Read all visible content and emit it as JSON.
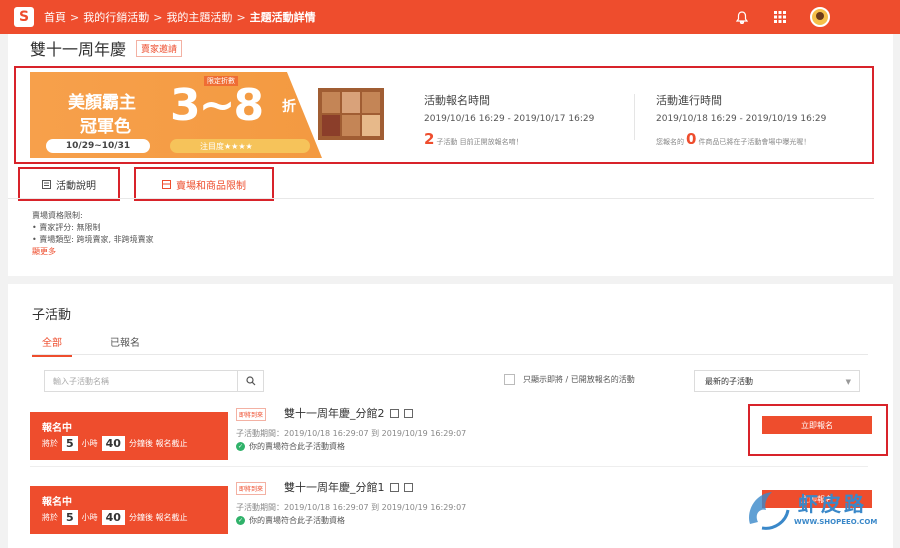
{
  "topbar": {
    "logo": "S",
    "breadcrumbs": [
      "首頁",
      "我的行銷活動",
      "我的主題活動",
      "主題活動詳情"
    ],
    "sep": ">"
  },
  "activity": {
    "title": "雙十一周年慶",
    "badge": "賣家邀請",
    "banner": {
      "line1": "美顏霸主",
      "line2": "冠軍色",
      "big": "3~8",
      "zhe": "折",
      "small": "限定折數",
      "date": "10/29~10/31",
      "stars": "注目度★★★★"
    },
    "register": {
      "label": "活動報名時間",
      "range": "2019/10/16 16:29 - 2019/10/17 16:29",
      "count": "2",
      "note": "子活動 目前正開放報名唷！"
    },
    "running": {
      "label": "活動進行時間",
      "range": "2019/10/18 16:29 - 2019/10/19 16:29",
      "prefix": "您報名的",
      "count": "0",
      "note": "件商品已將在子活動會場中曝光喔！"
    },
    "tabs": {
      "desc": "活動說明",
      "limits": "賣場和商品限制"
    },
    "requirements": {
      "title": "賣場資格限制:",
      "items": [
        "賣家評分: 無限制",
        "賣場類型: 跨境賣家, 非跨境賣家"
      ],
      "more": "顯更多"
    }
  },
  "sub": {
    "title": "子活動",
    "tab_all": "全部",
    "tab_signed": "已報名",
    "search_placeholder": "輸入子活動名稱",
    "filter_label": "只顯示即將 / 已開放報名的活動",
    "sort_value": "最新的子活動",
    "rows": [
      {
        "status": "報名中",
        "pre": "將於",
        "hours": "5",
        "hours_unit": "小時",
        "mins": "40",
        "mins_post": "分鐘後 報名截止",
        "tag": "即將到來",
        "name": "雙十一周年慶_分館2",
        "period": "子活動期間：2019/10/18 16:29:07 到 2019/10/19 16:29:07",
        "eligible": "你的賣場符合此子活動資格",
        "button": "立即報名"
      },
      {
        "status": "報名中",
        "pre": "將於",
        "hours": "5",
        "hours_unit": "小時",
        "mins": "40",
        "mins_post": "分鐘後 報名截止",
        "tag": "即將到來",
        "name": "雙十一周年慶_分館1",
        "period": "子活動期間：2019/10/18 16:29:07 到 2019/10/19 16:29:07",
        "eligible": "你的賣場符合此子活動資格",
        "button": "立即報名"
      }
    ]
  },
  "watermark": {
    "text": "虾皮路",
    "url": "WWW.SHOPEEO.COM"
  },
  "colors": {
    "brand": "#ee4d2d",
    "highlight_box": "#d8232a",
    "ok": "#30b26a"
  }
}
